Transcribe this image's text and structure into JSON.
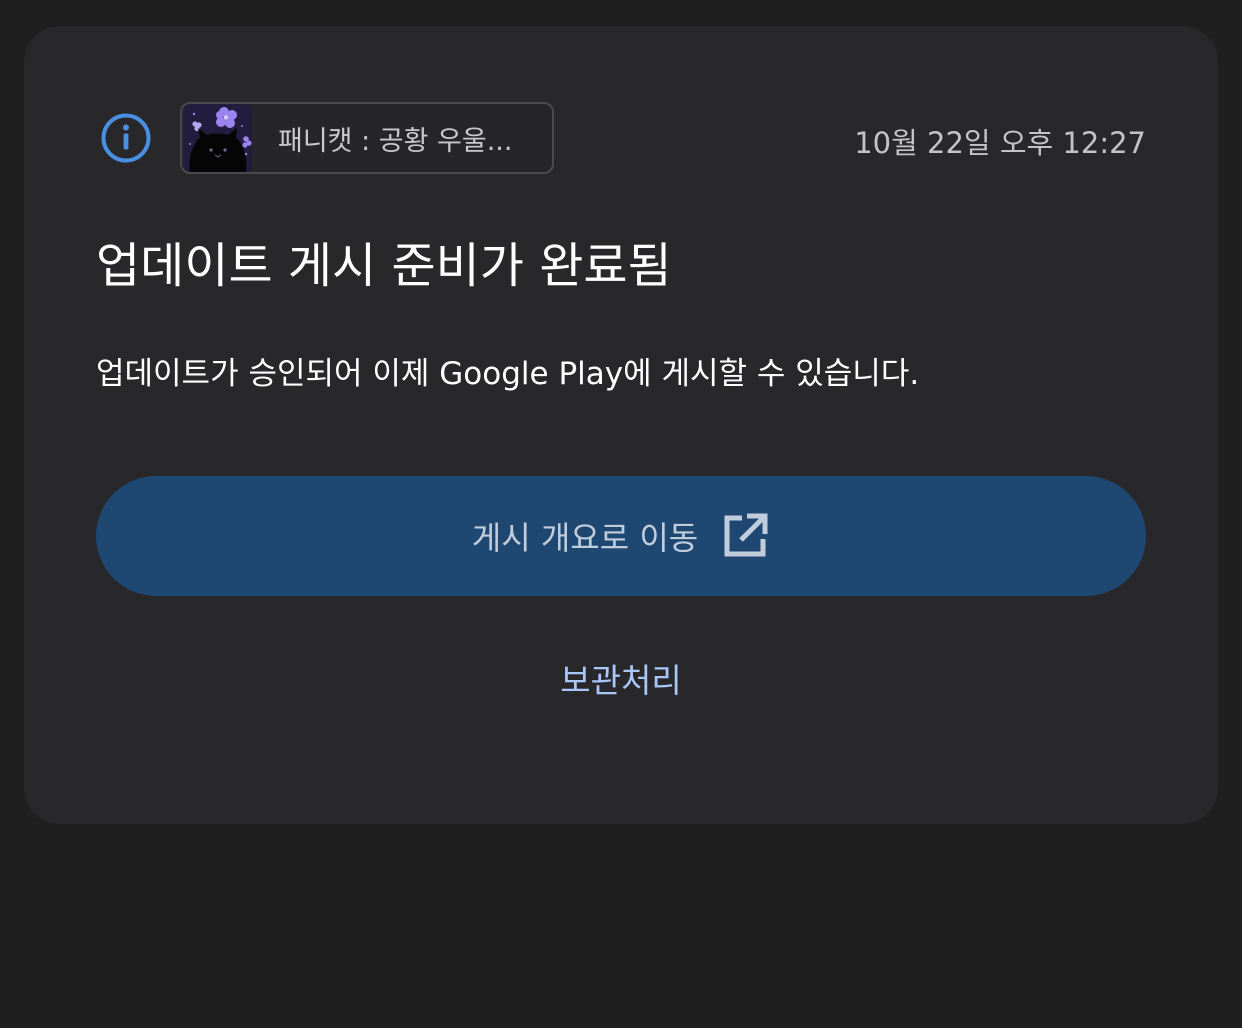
{
  "notification": {
    "app_name": "패니캣 : 공황 우울...",
    "timestamp": "10월 22일 오후 12:27",
    "title": "업데이트 게시 준비가 완료됨",
    "body": "업데이트가 승인되어 이제 Google Play에 게시할 수 있습니다.",
    "primary_action": "게시 개요로 이동",
    "secondary_action": "보관처리"
  },
  "icons": {
    "status": "info-icon",
    "primary_action": "open-in-new-icon",
    "app": "app-thumbnail-cat-icon"
  },
  "colors": {
    "page_background": "#1f1f1f",
    "card_background": "#28282b",
    "info_accent": "#4a90e2",
    "primary_button": "#1e4872",
    "primary_button_text": "#c2cddc",
    "link": "#a9c7fb"
  }
}
